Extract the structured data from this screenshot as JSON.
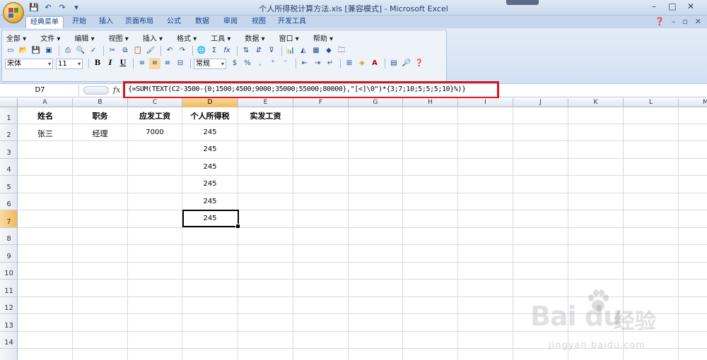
{
  "window": {
    "title": "个人所得税计算方法.xls  [兼容模式] - Microsoft Excel",
    "controls": [
      "–",
      "□",
      "✕"
    ]
  },
  "qat": {
    "items": [
      "💾",
      "↶",
      "↷",
      "▾"
    ]
  },
  "ribbon_tabs": [
    "经典菜单",
    "开始",
    "插入",
    "页面布局",
    "公式",
    "数据",
    "审阅",
    "视图",
    "开发工具"
  ],
  "active_tab": "经典菜单",
  "classic_menu": [
    "全部 ▾",
    "文件 ▾",
    "编辑 ▾",
    "视图 ▾",
    "插入 ▾",
    "格式 ▾",
    "工具 ▾",
    "数据 ▾",
    "窗口 ▾",
    "帮助 ▾"
  ],
  "font": {
    "name": "宋体",
    "size": "11",
    "number_format": "常规"
  },
  "format_buttons": {
    "bold": "B",
    "italic": "I",
    "underline": "U"
  },
  "name_box": "D7",
  "fx_label": "fx",
  "formula": "{=SUM(TEXT(C2-3500-{0;1500;4500;9000;35000;55000;80000},\"[<]\\0\")*{3;7;10;5;5;5;10}%)}",
  "columns": [
    "A",
    "B",
    "C",
    "D",
    "E",
    "F",
    "G",
    "H",
    "I",
    "J",
    "K",
    "L",
    "M"
  ],
  "rows": [
    "1",
    "2",
    "3",
    "4",
    "5",
    "6",
    "7",
    "8",
    "9",
    "10",
    "11",
    "12",
    "13",
    "14"
  ],
  "selected": {
    "column": "D",
    "row": "7"
  },
  "headers": [
    "姓名",
    "职务",
    "应发工资",
    "个人所得税",
    "实发工资"
  ],
  "row2": {
    "name": "张三",
    "title": "经理",
    "salary": "7000"
  },
  "tax_values": [
    "245",
    "245",
    "245",
    "245",
    "245",
    "245"
  ],
  "watermark": {
    "logo": "Bai du",
    "cn": "经验",
    "url": "jingyan.baidu.com"
  },
  "colors": {
    "highlight_box": "#d8161f",
    "selected_header": "#f1b95e",
    "ribbon": "#c5d6ed"
  }
}
